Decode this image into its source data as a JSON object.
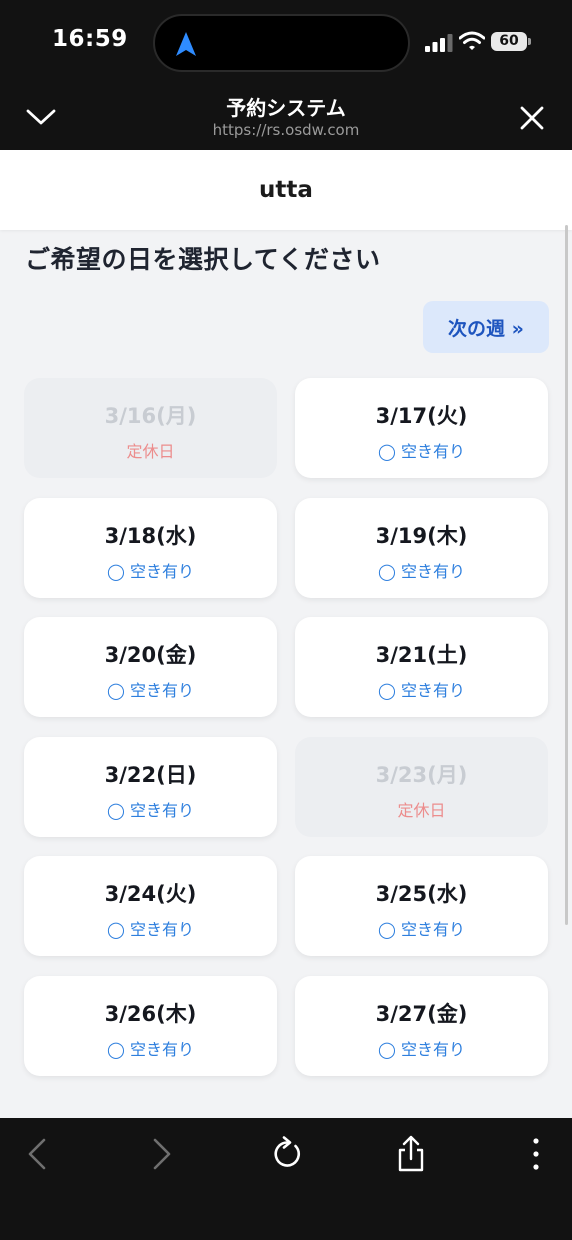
{
  "status_bar": {
    "time": "16:59",
    "battery": "60",
    "icons": [
      "location-arrow-icon",
      "signal-bars-icon",
      "wifi-icon",
      "battery-icon"
    ]
  },
  "browser": {
    "title": "予約システム",
    "url": "https://rs.osdw.com",
    "icons": [
      "chevron-down-icon",
      "close-icon"
    ]
  },
  "app": {
    "title": "utta",
    "heading": "ご希望の日を選択してください",
    "next_week_label": "次の週 »"
  },
  "days": [
    {
      "date": "3/16(月)",
      "status": "定休日",
      "available": false
    },
    {
      "date": "3/17(火)",
      "status": "◯ 空き有り",
      "available": true
    },
    {
      "date": "3/18(水)",
      "status": "◯ 空き有り",
      "available": true
    },
    {
      "date": "3/19(木)",
      "status": "◯ 空き有り",
      "available": true
    },
    {
      "date": "3/20(金)",
      "status": "◯ 空き有り",
      "available": true
    },
    {
      "date": "3/21(土)",
      "status": "◯ 空き有り",
      "available": true
    },
    {
      "date": "3/22(日)",
      "status": "◯ 空き有り",
      "available": true
    },
    {
      "date": "3/23(月)",
      "status": "定休日",
      "available": false
    },
    {
      "date": "3/24(火)",
      "status": "◯ 空き有り",
      "available": true
    },
    {
      "date": "3/25(水)",
      "status": "◯ 空き有り",
      "available": true
    },
    {
      "date": "3/26(木)",
      "status": "◯ 空き有り",
      "available": true
    },
    {
      "date": "3/27(金)",
      "status": "◯ 空き有り",
      "available": true
    }
  ],
  "colors": {
    "accent": "#1e55bf",
    "available": "#2e7fde",
    "closed": "#ec8d8d",
    "page_bg": "#f2f3f5",
    "chrome_bg": "#121212"
  },
  "toolbar": {
    "icons": [
      "back-arrow-icon",
      "forward-arrow-icon",
      "reload-icon",
      "share-icon",
      "more-icon"
    ]
  }
}
